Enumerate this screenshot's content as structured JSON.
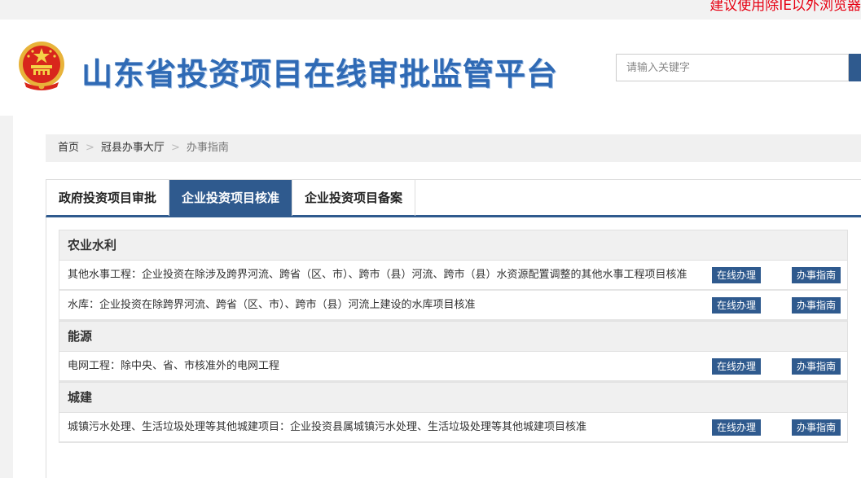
{
  "topbar": {
    "notice": "建议使用除IE以外浏览器"
  },
  "header": {
    "site_title": "山东省投资项目在线审批监管平台",
    "search_placeholder": "请输入关键字",
    "emblem_icon": "national-emblem-icon"
  },
  "breadcrumb": {
    "items": [
      "首页",
      "冠县办事大厅",
      "办事指南"
    ],
    "separator": ">"
  },
  "tabs": [
    {
      "label": "政府投资项目审批",
      "active": false
    },
    {
      "label": "企业投资项目核准",
      "active": true
    },
    {
      "label": "企业投资项目备案",
      "active": false
    }
  ],
  "categories": [
    {
      "name": "农业水利",
      "items": [
        {
          "text": "其他水事工程：企业投资在除涉及跨界河流、跨省（区、市）、跨市（县）河流、跨市（县）水资源配置调整的其他水事工程项目核准",
          "online_label": "在线办理",
          "guide_label": "办事指南"
        },
        {
          "text": "水库：企业投资在除跨界河流、跨省（区、市）、跨市（县）河流上建设的水库项目核准",
          "online_label": "在线办理",
          "guide_label": "办事指南"
        }
      ]
    },
    {
      "name": "能源",
      "items": [
        {
          "text": "电网工程：除中央、省、市核准外的电网工程",
          "online_label": "在线办理",
          "guide_label": "办事指南"
        }
      ]
    },
    {
      "name": "城建",
      "items": [
        {
          "text": "城镇污水处理、生活垃圾处理等其他城建项目：企业投资县属城镇污水处理、生活垃圾处理等其他城建项目核准",
          "online_label": "在线办理",
          "guide_label": "办事指南"
        }
      ]
    }
  ],
  "colors": {
    "primary": "#2f5a8e",
    "title_blue": "#2f6ab5",
    "notice_red": "#e60012",
    "light_gray": "#f0f0f0"
  }
}
